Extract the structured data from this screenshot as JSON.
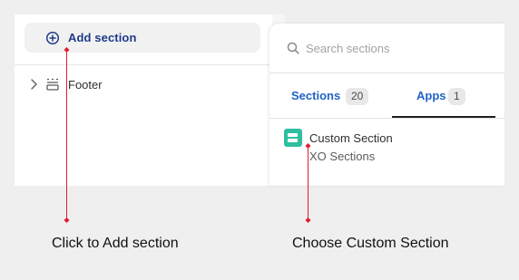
{
  "editor": {
    "add_section_label": "Add section",
    "footer_label": "Footer"
  },
  "picker": {
    "search_placeholder": "Search sections",
    "tabs": [
      {
        "label": "Sections",
        "count": "20",
        "active": false
      },
      {
        "label": "Apps",
        "count": "1",
        "active": true
      }
    ],
    "result": {
      "name": "Custom Section",
      "subtitle": "XO Sections",
      "icon": "custom-section-app-icon",
      "icon_color": "#2fbfa0"
    }
  },
  "annotations": {
    "left_caption": "Click to Add section",
    "right_caption": "Choose Custom Section",
    "marker_color": "#e11d2e"
  },
  "colors": {
    "background": "#efefef",
    "add_section_text": "#1f3b8a",
    "tab_text": "#2163c7"
  }
}
